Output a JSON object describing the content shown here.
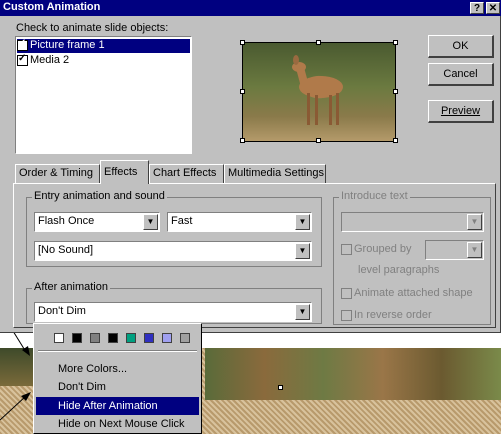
{
  "window": {
    "title": "Custom Animation",
    "help_btn": "?",
    "close_btn": "✕"
  },
  "objects": {
    "label": "Check to animate slide objects:",
    "items": [
      {
        "label": "Picture frame 1",
        "checked": true,
        "selected": true
      },
      {
        "label": "Media 2",
        "checked": true,
        "selected": false
      }
    ]
  },
  "buttons": {
    "ok": "OK",
    "cancel": "Cancel",
    "preview": "Preview"
  },
  "tabs": [
    {
      "label": "Order & Timing"
    },
    {
      "label": "Effects",
      "active": true
    },
    {
      "label": "Chart Effects"
    },
    {
      "label": "Multimedia Settings"
    }
  ],
  "effects": {
    "entry_group": "Entry animation and sound",
    "entry_effect": "Flash Once",
    "entry_speed": "Fast",
    "sound": "[No Sound]",
    "after_group": "After animation",
    "after_value": "Don't Dim",
    "introduce_group": "Introduce text",
    "grouped_by": "Grouped by",
    "level_paragraphs": "level paragraphs",
    "animate_attached": "Animate attached shape",
    "reverse_order": "In reverse order"
  },
  "popup": {
    "swatches": [
      "#ffffff",
      "#000000",
      "#808080",
      "#000000",
      "#00a080",
      "#3030c0",
      "#a0a0f0",
      "#a0a0a0"
    ],
    "items": [
      "More Colors...",
      "Don't Dim",
      "Hide After Animation",
      "Hide on Next Mouse Click"
    ],
    "selected_index": 2
  }
}
